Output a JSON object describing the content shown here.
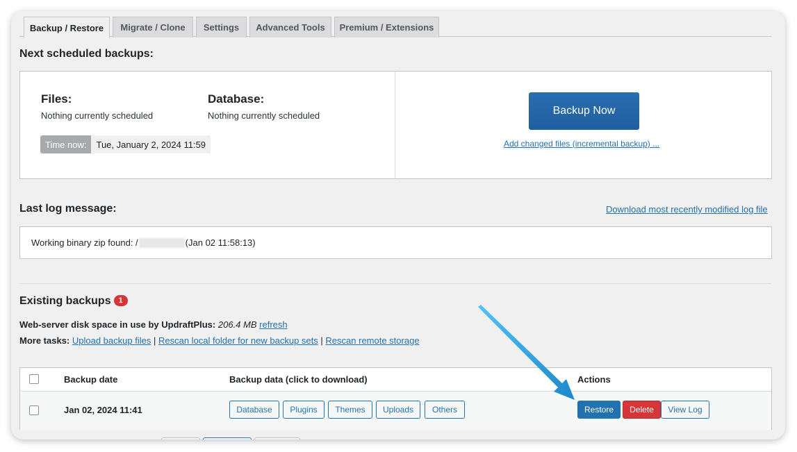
{
  "tabs": [
    {
      "label": "Backup / Restore",
      "active": true
    },
    {
      "label": "Migrate / Clone",
      "active": false
    },
    {
      "label": "Settings",
      "active": false
    },
    {
      "label": "Advanced Tools",
      "active": false
    },
    {
      "label": "Premium / Extensions",
      "active": false
    }
  ],
  "scheduled": {
    "heading": "Next scheduled backups:",
    "files_title": "Files:",
    "files_text": "Nothing currently scheduled",
    "database_title": "Database:",
    "database_text": "Nothing currently scheduled",
    "time_now_label": "Time now:",
    "time_now_value": "Tue, January 2, 2024 11:59",
    "backup_now_label": "Backup Now",
    "incremental_link": "Add changed files (incremental backup) ..."
  },
  "log": {
    "heading": "Last log message:",
    "download_link": "Download most recently modified log file",
    "message_prefix": "Working binary zip found: /",
    "message_suffix": "(Jan 02 11:58:13)"
  },
  "existing": {
    "heading": "Existing backups",
    "count": "1",
    "disk_label": "Web-server disk space in use by UpdraftPlus:",
    "disk_value": "206.4 MB",
    "refresh_link": "refresh",
    "more_tasks_label": "More tasks:",
    "task_links": [
      "Upload backup files",
      "Rescan local folder for new backup sets",
      "Rescan remote storage"
    ],
    "separator": "|"
  },
  "table": {
    "columns": [
      "Backup date",
      "Backup data (click to download)",
      "Actions"
    ],
    "rows": [
      {
        "date": "Jan 02, 2024 11:41",
        "data_buttons": [
          "Database",
          "Plugins",
          "Themes",
          "Uploads",
          "Others"
        ],
        "actions": {
          "restore": "Restore",
          "delete": "Delete",
          "view_log": "View Log"
        }
      }
    ]
  },
  "colors": {
    "primary": "#2271b1",
    "danger": "#d63638",
    "annotation_arrow": "#1e9bd7"
  }
}
